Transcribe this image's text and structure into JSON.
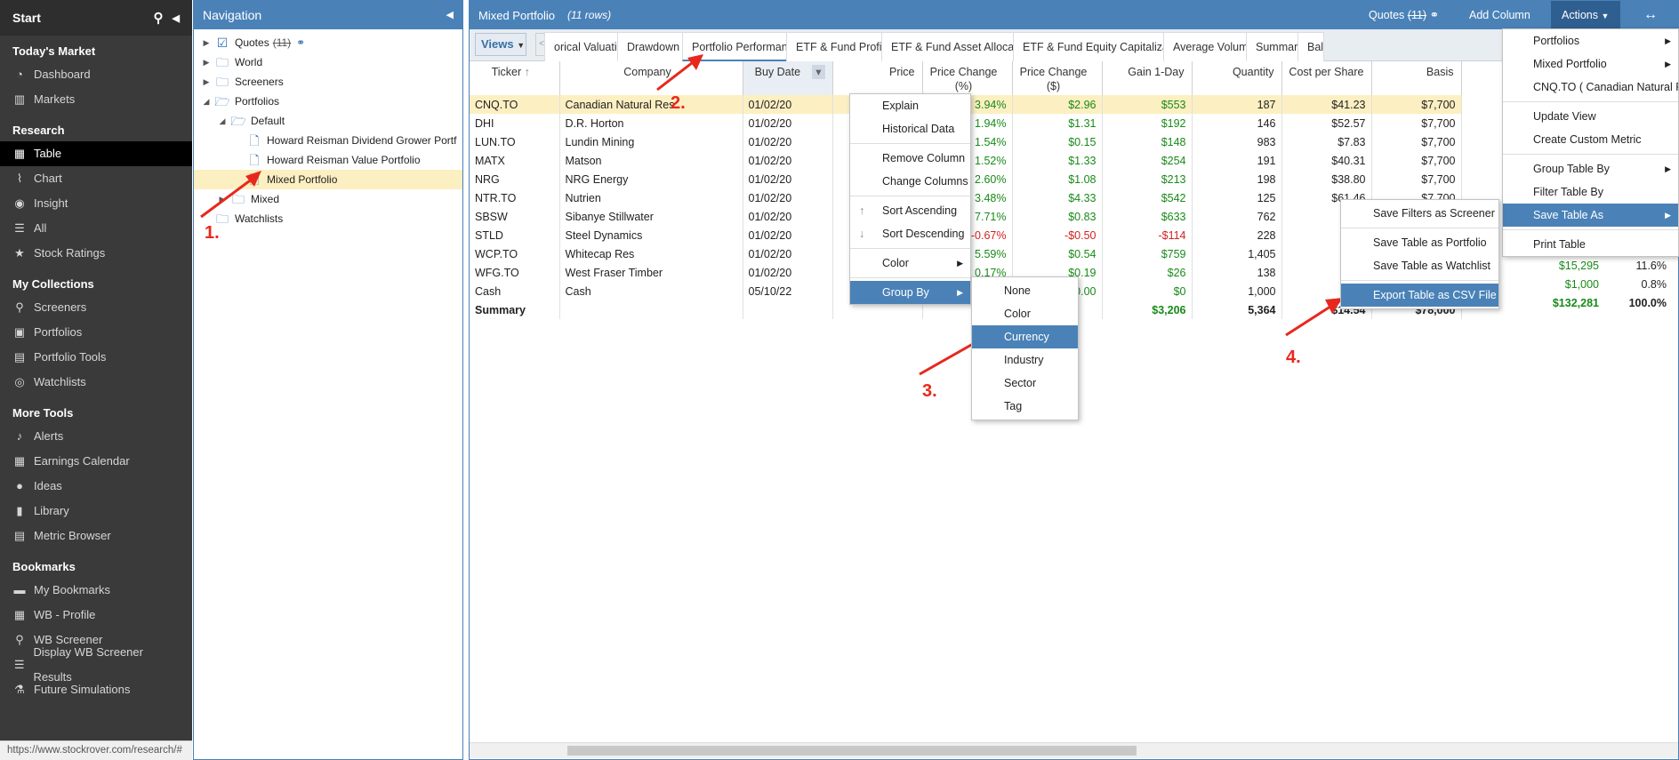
{
  "sidebar": {
    "start": "Start",
    "sections": [
      {
        "title": "Today's Market",
        "items": [
          {
            "icon": "dashboard-icon",
            "label": "Dashboard"
          },
          {
            "icon": "markets-icon",
            "label": "Markets"
          }
        ]
      },
      {
        "title": "Research",
        "items": [
          {
            "icon": "table-icon",
            "label": "Table",
            "active": true
          },
          {
            "icon": "chart-icon",
            "label": "Chart"
          },
          {
            "icon": "insight-icon",
            "label": "Insight"
          },
          {
            "icon": "list-icon",
            "label": "All"
          },
          {
            "icon": "star-icon",
            "label": "Stock Ratings"
          }
        ]
      },
      {
        "title": "My Collections",
        "items": [
          {
            "icon": "search-icon",
            "label": "Screeners"
          },
          {
            "icon": "briefcase-icon",
            "label": "Portfolios"
          },
          {
            "icon": "chart-bar-icon",
            "label": "Portfolio Tools"
          },
          {
            "icon": "binoculars-icon",
            "label": "Watchlists"
          }
        ]
      },
      {
        "title": "More Tools",
        "items": [
          {
            "icon": "bell-icon",
            "label": "Alerts"
          },
          {
            "icon": "calendar-icon",
            "label": "Earnings Calendar"
          },
          {
            "icon": "lightbulb-icon",
            "label": "Ideas"
          },
          {
            "icon": "book-icon",
            "label": "Library"
          },
          {
            "icon": "metric-icon",
            "label": "Metric Browser"
          }
        ]
      },
      {
        "title": "Bookmarks",
        "items": [
          {
            "icon": "bookmark-icon",
            "label": "My Bookmarks"
          },
          {
            "icon": "table-icon",
            "label": "WB - Profile"
          },
          {
            "icon": "search-icon",
            "label": "WB Screener"
          },
          {
            "icon": "list-icon",
            "label": "Display WB Screener Results"
          },
          {
            "icon": "flask-icon",
            "label": "Future Simulations"
          }
        ]
      }
    ],
    "status_url": "https://www.stockrover.com/research/#"
  },
  "nav": {
    "title": "Navigation",
    "tree": [
      {
        "label": "Quotes",
        "extra": "(11)",
        "icon": "checkbox-icon",
        "level": 0,
        "toggle": "▶"
      },
      {
        "label": "World",
        "icon": "folder-icon",
        "level": 0,
        "toggle": "▶"
      },
      {
        "label": "Screeners",
        "icon": "folder-icon",
        "level": 0,
        "toggle": "▶"
      },
      {
        "label": "Portfolios",
        "icon": "folder-open-icon",
        "level": 0,
        "toggle": "◢"
      },
      {
        "label": "Default",
        "icon": "folder-open-icon",
        "level": 1,
        "toggle": "◢"
      },
      {
        "label": "Howard Reisman Dividend Grower Portf",
        "icon": "file-icon",
        "level": 2,
        "toggle": ""
      },
      {
        "label": "Howard Reisman Value Portfolio",
        "icon": "file-icon",
        "level": 2,
        "toggle": ""
      },
      {
        "label": "Mixed Portfolio",
        "icon": "file-icon",
        "level": 2,
        "toggle": "",
        "selected": true
      },
      {
        "label": "Mixed",
        "icon": "folder-icon",
        "level": 1,
        "toggle": "▶"
      },
      {
        "label": "Watchlists",
        "icon": "folder-icon",
        "level": 0,
        "toggle": ""
      }
    ]
  },
  "main": {
    "title": "Mixed Portfolio",
    "rows_note": "(11 rows)",
    "quotes_btn": "Quotes",
    "quotes_count": "(11)",
    "add_column": "Add Column",
    "actions": "Actions",
    "views": "Views",
    "tabs": [
      "orical Valuation",
      "Drawdown",
      "Portfolio Performance",
      "ETF & Fund Profile",
      "ETF & Fund Asset Allocation",
      "ETF & Fund Equity Capitalization",
      "Average Volume",
      "Summary",
      "Bal"
    ],
    "columns": [
      "Ticker",
      "Company",
      "Buy Date",
      "Price",
      "Price Change (%)",
      "Price Change ($)",
      "Gain 1-Day",
      "Quantity",
      "Cost per Share",
      "Basis"
    ],
    "rows": [
      [
        "CNQ.TO",
        "Canadian Natural Res",
        "01/02/20",
        "",
        "3.94%",
        "$2.96",
        "$553",
        "187",
        "$41.23",
        "$7,700"
      ],
      [
        "DHI",
        "D.R. Horton",
        "01/02/20",
        "",
        "1.94%",
        "$1.31",
        "$192",
        "146",
        "$52.57",
        "$7,700"
      ],
      [
        "LUN.TO",
        "Lundin Mining",
        "01/02/20",
        "",
        "1.54%",
        "$0.15",
        "$148",
        "983",
        "$7.83",
        "$7,700"
      ],
      [
        "MATX",
        "Matson",
        "01/02/20",
        "",
        "1.52%",
        "$1.33",
        "$254",
        "191",
        "$40.31",
        "$7,700"
      ],
      [
        "NRG",
        "NRG Energy",
        "01/02/20",
        "",
        "2.60%",
        "$1.08",
        "$213",
        "198",
        "$38.80",
        "$7,700"
      ],
      [
        "NTR.TO",
        "Nutrien",
        "01/02/20",
        "",
        "3.48%",
        "$4.33",
        "$542",
        "125",
        "$61.46",
        "$7,700"
      ],
      [
        "SBSW",
        "Sibanye Stillwater",
        "01/02/20",
        "",
        "7.71%",
        "$0.83",
        "$633",
        "762",
        "",
        ""
      ],
      [
        "STLD",
        "Steel Dynamics",
        "01/02/20",
        "",
        "-0.67%",
        "-$0.50",
        "-$114",
        "228",
        "",
        ""
      ],
      [
        "WCP.TO",
        "Whitecap Res",
        "01/02/20",
        "",
        "5.59%",
        "$0.54",
        "$759",
        "1,405",
        "",
        ""
      ],
      [
        "WFG.TO",
        "West Fraser Timber",
        "01/02/20",
        "",
        "0.17%",
        "$0.19",
        "$26",
        "138",
        "",
        ""
      ],
      [
        "Cash",
        "Cash",
        "05/10/22",
        "",
        "",
        "$0.00",
        "$0",
        "1,000",
        "",
        ""
      ]
    ],
    "summary": [
      "Summary",
      "",
      "",
      "",
      "",
      "",
      "$3,206",
      "5,364",
      "$14.54",
      "$78,000"
    ],
    "extra_cols": [
      [
        "$14,332",
        "10.8%"
      ],
      [
        "$15,295",
        "11.6%"
      ],
      [
        "$1,000",
        "0.8%"
      ],
      [
        "$132,281",
        "100.0%"
      ]
    ]
  },
  "col_menu": {
    "items": [
      "Explain",
      "Historical Data",
      "Remove Column",
      "Change Columns",
      "Sort Ascending",
      "Sort Descending",
      "Color",
      "Group By"
    ]
  },
  "group_menu": {
    "items": [
      "None",
      "Color",
      "Currency",
      "Industry",
      "Sector",
      "Tag"
    ]
  },
  "actions_menu": {
    "items": [
      "Portfolios",
      "Mixed Portfolio",
      "CNQ.TO ( Canadian Natural Resources )",
      "Update View",
      "Create Custom Metric",
      "Group Table By",
      "Filter Table By",
      "Save Table As",
      "Print Table"
    ]
  },
  "save_menu": {
    "items": [
      "Save Filters as Screener",
      "Save Table as Portfolio",
      "Save Table as Watchlist",
      "Export Table as CSV File"
    ]
  },
  "annotations": [
    "1.",
    "2.",
    "3.",
    "4."
  ]
}
